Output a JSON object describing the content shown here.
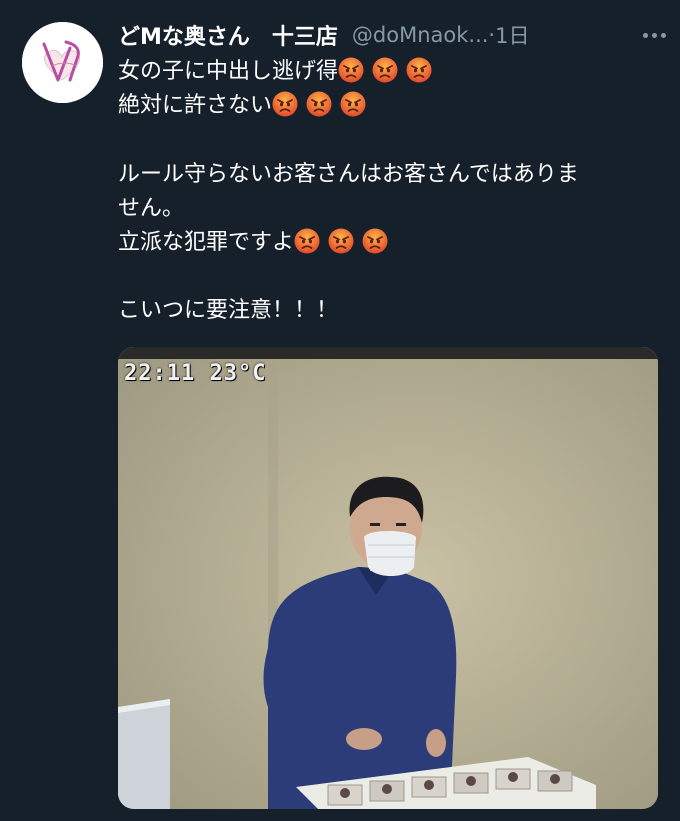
{
  "tweet": {
    "display_name": "どMな奥さん　十三店",
    "handle": "@doMnaok...",
    "separator": "·",
    "time": "1日",
    "lines": [
      {
        "text": "女の子に中出し逃げ得",
        "emoji_count": 3
      },
      {
        "text": "絶対に許さない",
        "emoji_count": 3
      },
      {
        "text": "",
        "emoji_count": 0
      },
      {
        "text": "ルール守らないお客さんはお客さんではありま",
        "emoji_count": 0
      },
      {
        "text": "せん。",
        "emoji_count": 0
      },
      {
        "text": "立派な犯罪ですよ",
        "emoji_count": 3
      },
      {
        "text": "",
        "emoji_count": 0
      },
      {
        "text": "こいつに要注意！！！",
        "emoji_count": 0
      }
    ],
    "emoji_name": "angry-face-icon",
    "media": {
      "timestamp_overlay": "22:11 23°C"
    }
  },
  "colors": {
    "background": "#15202b",
    "secondary_text": "#8899a6",
    "primary_text": "#ffffff",
    "avatar_accent": "#b84ea0"
  }
}
